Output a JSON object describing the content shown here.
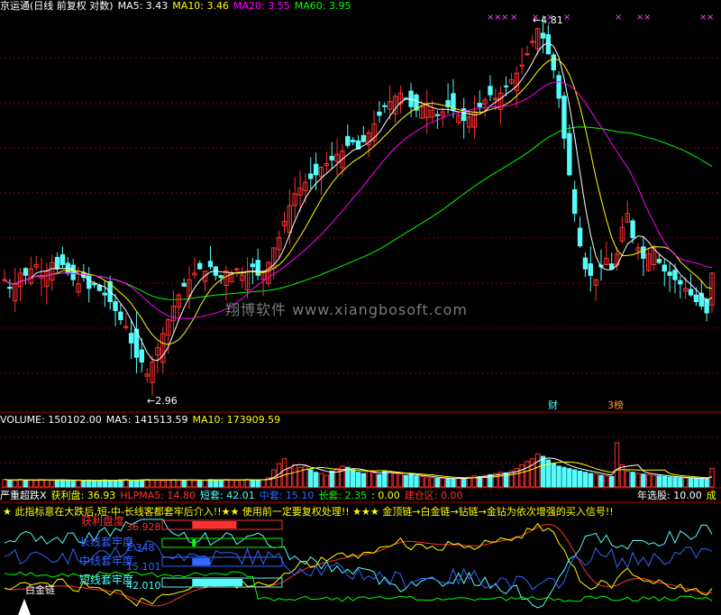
{
  "colors": {
    "up": "#ff3232",
    "down": "#54fcfc",
    "ma5": "#ffffff",
    "ma10": "#ffff00",
    "ma20": "#ff00ff",
    "ma60": "#00ff00",
    "grid": "#880000",
    "border": "#aa0000",
    "bg": "#000000"
  },
  "main_header": {
    "title": "京运通(日线 前复权 对数)",
    "ma5": "MA5: 3.43",
    "ma10": "MA10: 3.46",
    "ma20": "MA20: 3.55",
    "ma60": "MA60: 3.95"
  },
  "price_labels": {
    "high": "4.81",
    "low": "2.96"
  },
  "events": {
    "e1": "财",
    "e2": "3榜"
  },
  "watermark": "翔博软件 www.xiangbosoft.com",
  "volume_header": {
    "label": "VOLUME: 150102.00",
    "ma5": "MA5: 141513.59",
    "ma10": "MA10: 173909.59"
  },
  "indicator_header": {
    "name": "严重超跌X",
    "profit": "获利盘: 36.93",
    "hlpma5": "HLPMA5: 14.80",
    "short": "短套: 42.01",
    "mid": "中套: 15.10",
    "long": "长套: 2.35",
    "zero": ": 0.00",
    "build": "建仓区: 0.00",
    "year_label": "年选股: 10.00",
    "cut": "成"
  },
  "notice": "★ 此指标意在大跌后,短-中-长线客都套牢后介入!!★★ 使用前一定要复权处理!! ★★★ 金顶链→白金链→钻链→金钻为依次增强的买入信号!!",
  "panel_labels": {
    "profit": "获利盘度",
    "profit_val": "36.928",
    "long": "长线套牢度",
    "long_val": "2.348",
    "mid": "中线套牢度",
    "mid_val": "15.101",
    "short": "短线套牢度",
    "short_val": "42.010",
    "chain": "白金链"
  },
  "chart_data": [
    {
      "type": "candlestick",
      "title": "京运通(日线 前复权 对数)",
      "ylim": [
        2.9,
        4.85
      ],
      "y_scale": "log",
      "high_marker": 4.81,
      "low_marker": 2.96,
      "series": [
        {
          "name": "MA5",
          "value": 3.43
        },
        {
          "name": "MA10",
          "value": 3.46
        },
        {
          "name": "MA20",
          "value": 3.55
        },
        {
          "name": "MA60",
          "value": 3.95
        }
      ],
      "close": [
        3.4,
        3.36,
        3.38,
        3.43,
        3.42,
        3.45,
        3.47,
        3.42,
        3.44,
        3.48,
        3.45,
        3.47,
        3.43,
        3.4,
        3.38,
        3.41,
        3.36,
        3.38,
        3.35,
        3.33,
        3.3,
        3.26,
        3.22,
        3.19,
        3.12,
        3.06,
        3.04,
        2.99,
        3.04,
        3.1,
        3.16,
        3.22,
        3.28,
        3.33,
        3.37,
        3.4,
        3.43,
        3.45,
        3.44,
        3.46,
        3.42,
        3.41,
        3.44,
        3.43,
        3.45,
        3.42,
        3.44,
        3.46,
        3.42,
        3.44,
        3.48,
        3.55,
        3.6,
        3.68,
        3.76,
        3.82,
        3.85,
        3.88,
        3.9,
        3.92,
        3.96,
        3.98,
        4.0,
        4.03,
        4.05,
        4.08,
        4.1,
        4.06,
        4.1,
        4.15,
        4.2,
        4.25,
        4.3,
        4.33,
        4.36,
        4.38,
        4.35,
        4.3,
        4.28,
        4.3,
        4.32,
        4.28,
        4.25,
        4.27,
        4.3,
        4.28,
        4.25,
        4.22,
        4.24,
        4.27,
        4.3,
        4.34,
        4.37,
        4.35,
        4.38,
        4.42,
        4.46,
        4.5,
        4.55,
        4.62,
        4.7,
        4.78,
        4.72,
        4.62,
        4.52,
        4.35,
        4.12,
        3.92,
        3.72,
        3.56,
        3.45,
        3.42,
        3.4,
        3.46,
        3.5,
        3.45,
        3.52,
        3.65,
        3.72,
        3.6,
        3.55,
        3.5,
        3.52,
        3.55,
        3.48,
        3.44,
        3.42,
        3.4,
        3.38,
        3.36,
        3.33,
        3.3,
        3.28,
        3.25,
        3.43
      ]
    },
    {
      "type": "bar",
      "title": "VOLUME",
      "ylim": [
        0,
        500000
      ],
      "series": [
        {
          "name": "VOLUME",
          "value": 150102.0
        },
        {
          "name": "MA5",
          "value": 141513.59
        },
        {
          "name": "MA10",
          "value": 173909.59
        }
      ],
      "values": [
        60000,
        55000,
        58000,
        62000,
        52000,
        57000,
        54000,
        61000,
        59000,
        53000,
        56000,
        58000,
        55000,
        52000,
        54000,
        51000,
        56000,
        53000,
        55000,
        57000,
        52000,
        54000,
        58000,
        61000,
        55000,
        52000,
        57000,
        62000,
        58000,
        56000,
        52000,
        55000,
        60000,
        57000,
        54000,
        58000,
        53000,
        56000,
        55000,
        60000,
        58000,
        57000,
        61000,
        56000,
        54000,
        59000,
        62000,
        58000,
        56000,
        60000,
        75000,
        140000,
        190000,
        230000,
        150000,
        180000,
        160000,
        170000,
        140000,
        120000,
        110000,
        95000,
        130000,
        150000,
        170000,
        160000,
        140000,
        120000,
        110000,
        125000,
        115000,
        100000,
        130000,
        120000,
        110000,
        105000,
        95000,
        100000,
        90000,
        85000,
        80000,
        75000,
        70000,
        72000,
        68000,
        65000,
        70000,
        75000,
        80000,
        90000,
        85000,
        95000,
        100000,
        110000,
        120000,
        115000,
        130000,
        150000,
        180000,
        210000,
        230000,
        270000,
        250000,
        220000,
        190000,
        170000,
        160000,
        150000,
        140000,
        130000,
        120000,
        110000,
        105000,
        95000,
        90000,
        85000,
        360000,
        180000,
        130000,
        120000,
        110000,
        105000,
        100000,
        95000,
        90000,
        85000,
        80000,
        78000,
        75000,
        72000,
        70000,
        68000,
        66000,
        65000,
        150102
      ]
    },
    {
      "type": "line",
      "title": "严重超跌X",
      "ylim": [
        0,
        100
      ],
      "series": [
        {
          "name": "获利盘",
          "value": 36.93
        },
        {
          "name": "HLPMA5",
          "value": 14.8
        },
        {
          "name": "短套",
          "value": 42.01
        },
        {
          "name": "中套",
          "value": 15.1
        },
        {
          "name": "长套",
          "value": 2.35
        },
        {
          "name": "建仓区",
          "value": 0.0
        },
        {
          "name": "年选股",
          "value": 10.0
        }
      ]
    }
  ]
}
